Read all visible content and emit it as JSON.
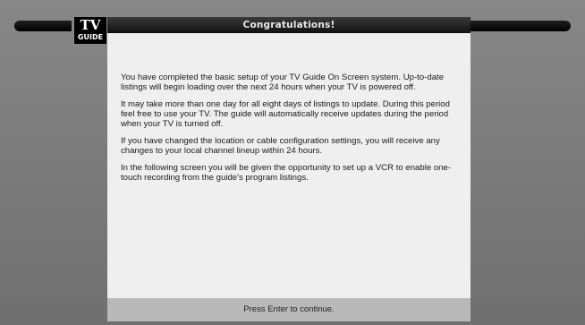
{
  "logo": {
    "line1": "TV",
    "line2": "GUIDE"
  },
  "header": {
    "title": "Congratulations!"
  },
  "content": {
    "paragraphs": [
      "You have completed the basic setup of your TV Guide On Screen system.  Up-to-date listings will begin loading over the next 24 hours when your TV is powered off.",
      "It may take more than one day for all eight days of listings to update.  During this period feel free to use your TV.  The guide will automatically receive updates during the period when your TV is turned off.",
      "If you have changed the location or cable configuration settings, you will receive any changes to your local channel lineup within 24 hours.",
      "In the following screen you will be given the opportunity to set up a VCR to enable one-touch recording from the guide's program listings."
    ]
  },
  "footer": {
    "prompt": "Press Enter to continue."
  },
  "colors": {
    "background": "#7a7a7a",
    "panel": "#efefef",
    "footer": "#b9b9b9",
    "title_bar": "#1a1a1a"
  }
}
